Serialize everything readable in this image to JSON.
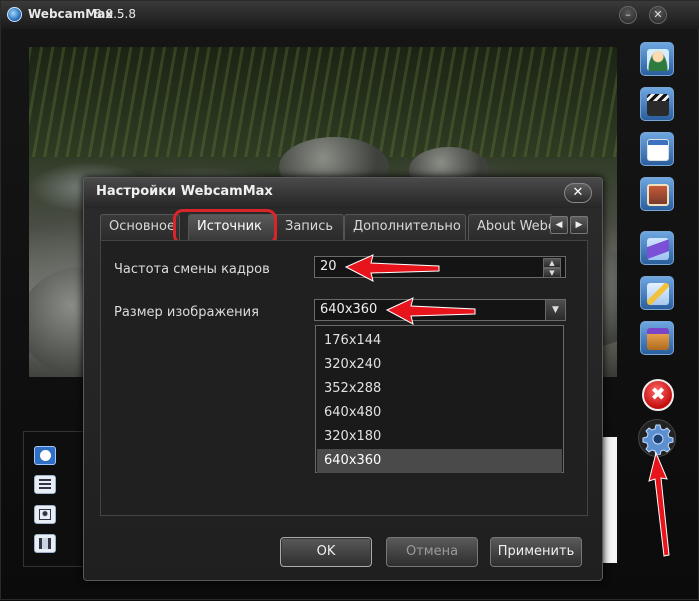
{
  "app": {
    "title": "WebcamMax",
    "version": "8.0.5.8"
  },
  "window_controls": {
    "minimize": "–",
    "close": "✕"
  },
  "toolbar": {
    "icons": [
      "user-icon",
      "clapper-icon",
      "window-icon",
      "picture-icon",
      "wizard-icon",
      "pencil-icon",
      "box-icon"
    ],
    "close_glyph": "✖",
    "settings_icon": "gear-icon"
  },
  "dialog": {
    "title": "Настройки WebcamMax",
    "close_glyph": "✕",
    "tabs": [
      "Основное",
      "Источник",
      "Запись",
      "Дополнительно",
      "About Webcam"
    ],
    "active_tab": "Источник",
    "tab_scroll": {
      "left": "◀",
      "right": "▶"
    },
    "fps_label": "Частота смены кадров",
    "fps_value": "20",
    "size_label": "Размер изображения",
    "size_value": "640x360",
    "size_options": [
      "176x144",
      "320x240",
      "352x288",
      "640x480",
      "320x180",
      "640x360"
    ],
    "selected_option": "640x360",
    "buttons": {
      "ok": "OK",
      "cancel": "Отмена",
      "apply": "Применить"
    }
  },
  "colors": {
    "accent": "#2a5e9e",
    "highlight": "#d9242a",
    "arrow": "#e8141c"
  }
}
